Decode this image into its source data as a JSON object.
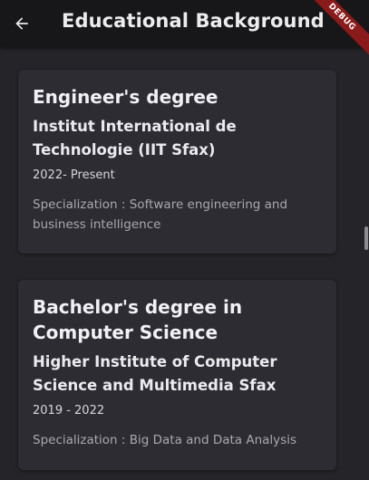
{
  "appbar": {
    "title": "Educational Background",
    "back_icon": "arrow-back-icon",
    "debug_label": "DEBUG"
  },
  "education": [
    {
      "degree": "Engineer's degree",
      "institution": "Institut International de Technologie (IIT Sfax)",
      "period": "2022- Present",
      "specialization": "Specialization : Software engineering and business intelligence"
    },
    {
      "degree": "Bachelor's degree in Computer Science",
      "institution": "Higher Institute of Computer Science and Multimedia Sfax",
      "period": "2019 - 2022",
      "specialization": "Specialization : Big Data and Data Analysis"
    }
  ],
  "colors": {
    "appbar_bg": "#17171a",
    "page_bg": "#252428",
    "card_bg": "#2e2c33",
    "debug_banner": "#8b1a1a"
  }
}
